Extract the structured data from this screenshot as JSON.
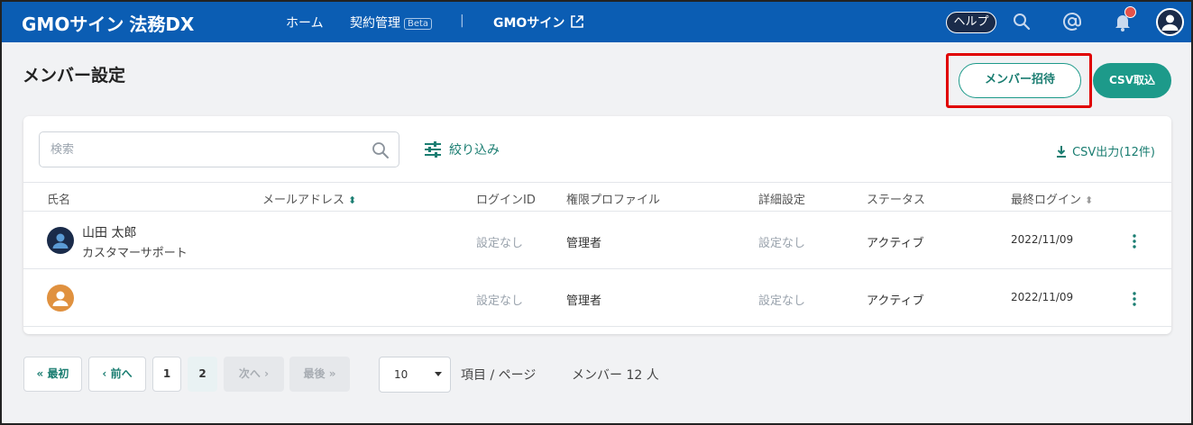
{
  "header": {
    "logo": "GMOサイン",
    "product": "法務DX",
    "nav": [
      {
        "label": "ホーム"
      },
      {
        "label": "契約管理",
        "badge": "Beta"
      },
      {
        "label": "|"
      },
      {
        "label": "GMOサイン"
      }
    ],
    "help_label": "ヘルプ",
    "icons": [
      "search-icon",
      "mention-icon",
      "bell-icon",
      "account-icon"
    ]
  },
  "page": {
    "title": "メンバー設定",
    "invite_button": "メンバー招待",
    "csv_import_button": "CSV取込"
  },
  "toolbar": {
    "search_placeholder": "検索",
    "filter_label": "絞り込み",
    "csv_export_label": "CSV出力(12件)"
  },
  "table": {
    "columns": [
      "氏名",
      "メールアドレス",
      "ログインID",
      "権限プロファイル",
      "詳細設定",
      "ステータス",
      "最終ログイン"
    ],
    "rows": [
      {
        "name": "山田 太郎",
        "department": "カスタマーサポート",
        "email": "",
        "login_id": "設定なし",
        "profile": "管理者",
        "detail": "設定なし",
        "status": "アクティブ",
        "last_login": "2022/11/09",
        "avatar_color": "#1a2b4a"
      },
      {
        "name": "",
        "department": "",
        "email": "",
        "login_id": "設定なし",
        "profile": "管理者",
        "detail": "設定なし",
        "status": "アクティブ",
        "last_login": "2022/11/09",
        "avatar_color": "#e0913f"
      }
    ]
  },
  "pagination": {
    "first_label": "最初",
    "prev_label": "前へ",
    "pages": [
      "1",
      "2"
    ],
    "current_page": "2",
    "next_label": "次へ",
    "last_label": "最後",
    "per_page_value": "10",
    "per_page_suffix": "項目 / ページ",
    "members_total": "メンバー 12 人"
  },
  "colors": {
    "header_bg": "#0b5db3",
    "accent": "#1d9a8a",
    "highlight": "#e00000"
  }
}
